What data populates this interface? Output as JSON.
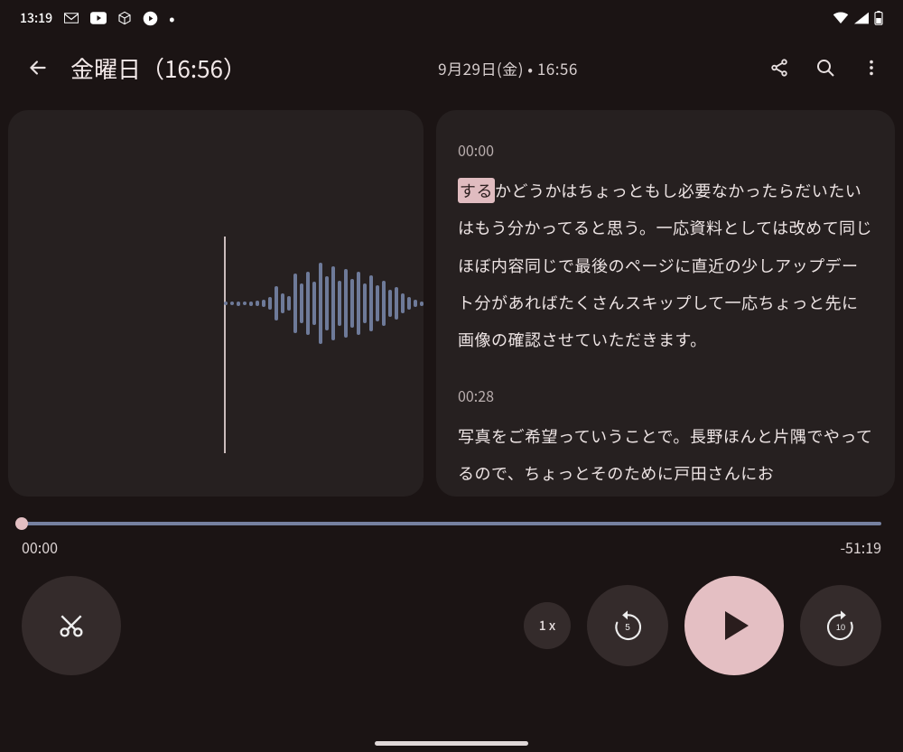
{
  "status": {
    "time": "13:19",
    "icons": [
      "gmail-icon",
      "youtube-icon",
      "package-icon",
      "play-circle-icon",
      "dot-icon"
    ],
    "right_icons": [
      "wifi-icon",
      "signal-icon",
      "battery-icon"
    ]
  },
  "header": {
    "back_icon": "arrow-back-icon",
    "title": "金曜日（16:56）",
    "subtitle": "9月29日(金) • 16:56",
    "actions": [
      "share-icon",
      "search-icon",
      "more-icon"
    ]
  },
  "waveform": {
    "bars": [
      4,
      4,
      5,
      4,
      5,
      6,
      8,
      14,
      38,
      22,
      16,
      66,
      44,
      70,
      48,
      90,
      60,
      82,
      50,
      76,
      54,
      70,
      44,
      62,
      40,
      50,
      30,
      36,
      22,
      14,
      8,
      5,
      5,
      4
    ]
  },
  "transcript": {
    "blocks": [
      {
        "time": "00:00",
        "highlight": "する",
        "text": "かどうかはちょっともし必要なかったらだいたいはもう分かってると思う。一応資料としては改めて同じほぼ内容同じで最後のページに直近の少しアップデート分があればたくさんスキップして一応ちょっと先に画像の確認させていただきます。"
      },
      {
        "time": "00:28",
        "text": "写真をご希望っていうことで。長野ほんと片隅でやってるので、ちょっとそのために戸田さんにお"
      }
    ]
  },
  "playback": {
    "current": "00:00",
    "remaining": "-51:19",
    "speed_label": "1 x",
    "rewind_seconds": "5",
    "forward_seconds": "10"
  },
  "controls": {
    "trim_icon": "scissors-icon",
    "rewind_icon": "replay-5-icon",
    "play_icon": "play-icon",
    "forward_icon": "forward-10-icon",
    "speed_btn": "playback-speed-button"
  }
}
